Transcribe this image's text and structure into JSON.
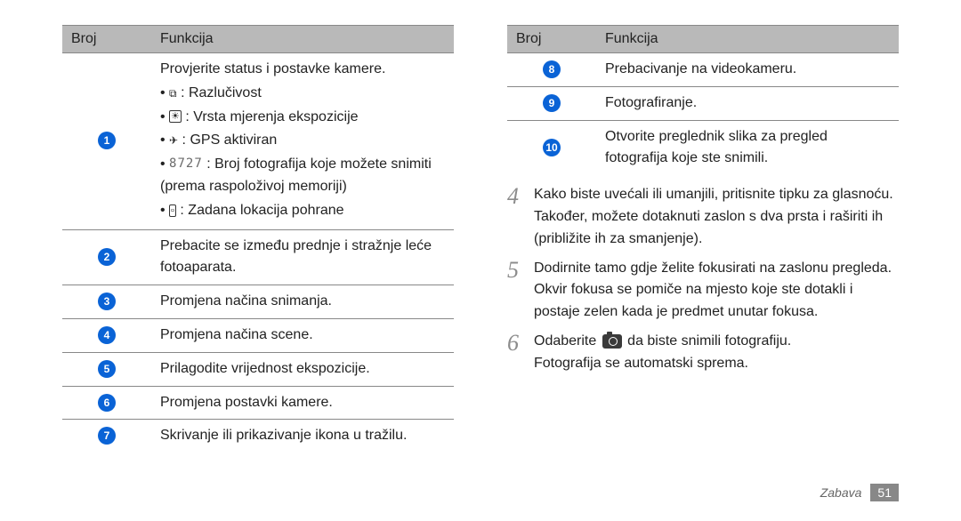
{
  "leftTable": {
    "headers": {
      "num": "Broj",
      "func": "Funkcija"
    },
    "rows": [
      {
        "num": "1",
        "lead": "Provjerite status i postavke kamere.",
        "items": [
          {
            "iconName": "resolution-icon",
            "iconChar": "⧉",
            "text": " : Razlučivost"
          },
          {
            "iconName": "metering-icon",
            "iconFrame": "☀",
            "text": " : Vrsta mjerenja ekspozicije"
          },
          {
            "iconName": "gps-icon",
            "iconChar": "✈",
            "text": " : GPS aktiviran"
          },
          {
            "iconName": "counter-icon",
            "seg7": "8727",
            "text": " : Broj fotografija koje možete snimiti (prema raspoloživoj memoriji)"
          },
          {
            "iconName": "storage-icon",
            "iconFrame": "□",
            "text": " : Zadana lokacija pohrane"
          }
        ]
      },
      {
        "num": "2",
        "text": "Prebacite se između prednje i stražnje leće fotoaparata."
      },
      {
        "num": "3",
        "text": "Promjena načina snimanja."
      },
      {
        "num": "4",
        "text": "Promjena načina scene."
      },
      {
        "num": "5",
        "text": "Prilagodite vrijednost ekspozicije."
      },
      {
        "num": "6",
        "text": "Promjena postavki kamere."
      },
      {
        "num": "7",
        "text": "Skrivanje ili prikazivanje ikona u tražilu."
      }
    ]
  },
  "rightTable": {
    "headers": {
      "num": "Broj",
      "func": "Funkcija"
    },
    "rows": [
      {
        "num": "8",
        "text": "Prebacivanje na videokameru."
      },
      {
        "num": "9",
        "text": "Fotografiranje."
      },
      {
        "num": "10",
        "text": "Otvorite preglednik slika za pregled fotografija koje ste snimili."
      }
    ]
  },
  "steps": [
    {
      "n": "4",
      "text": "Kako biste uvećali ili umanjili, pritisnite tipku za glasnoću. Također, možete dotaknuti zaslon s dva prsta i raširiti ih (približite ih za smanjenje)."
    },
    {
      "n": "5",
      "text": "Dodirnite tamo gdje želite fokusirati na zaslonu pregleda.",
      "extra": "Okvir fokusa se pomiče na mjesto koje ste dotakli i postaje zelen kada je predmet unutar fokusa."
    },
    {
      "n": "6",
      "preIconText": "Odaberite ",
      "postIconText": " da biste snimili fotografiju.",
      "extra": "Fotografija se automatski sprema."
    }
  ],
  "footer": {
    "section": "Zabava",
    "page": "51"
  }
}
